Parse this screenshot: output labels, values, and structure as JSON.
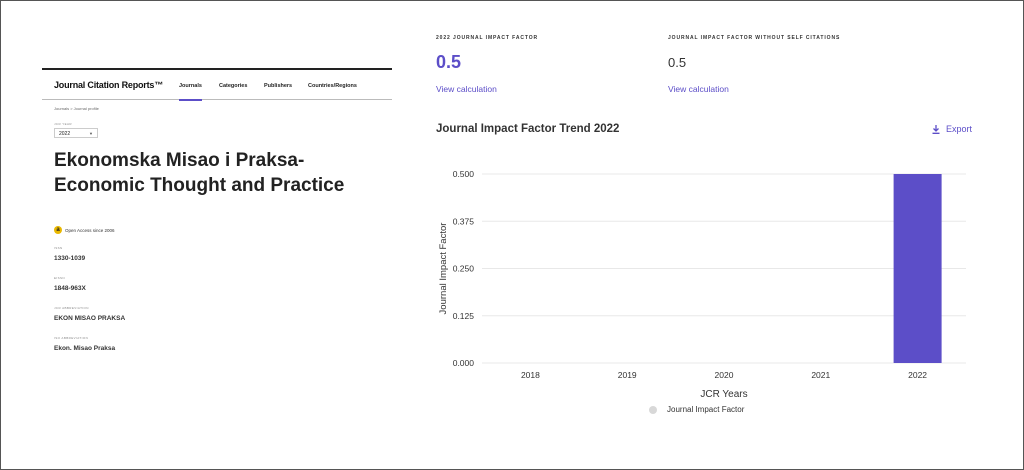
{
  "jcr": {
    "brand": "Journal Citation Reports™",
    "nav": [
      "Journals",
      "Categories",
      "Publishers",
      "Countries/Regions"
    ],
    "breadcrumb": "Journals  >  Journal profile",
    "year_label": "JCR YEAR",
    "year_value": "2022",
    "journal_title": "Ekonomska Misao i Praksa-Economic Thought and Practice",
    "open_access": "Open Access since 2006",
    "fields": [
      {
        "label": "ISSN",
        "value": "1330-1039"
      },
      {
        "label": "EISSN",
        "value": "1848-963X"
      },
      {
        "label": "JCR ABBREVIATION",
        "value": "EKON MISAO PRAKSA"
      },
      {
        "label": "ISO ABBREVIATION",
        "value": "Ekon. Misao Praksa"
      }
    ]
  },
  "kpis": {
    "jif_label": "2022 JOURNAL IMPACT FACTOR",
    "jif_value": "0.5",
    "jif_link": "View calculation",
    "jif_nsc_label": "JOURNAL IMPACT FACTOR WITHOUT SELF CITATIONS",
    "jif_nsc_value": "0.5",
    "jif_nsc_link": "View calculation"
  },
  "trend": {
    "title": "Journal Impact Factor Trend 2022",
    "export_label": "Export"
  },
  "colors": {
    "accent": "#5c4ec8",
    "bar": "#5c4ec8",
    "grid": "#e8e8e8",
    "legend_dot": "#d8d8d8"
  },
  "chart_data": {
    "type": "bar",
    "categories": [
      "2018",
      "2019",
      "2020",
      "2021",
      "2022"
    ],
    "series": [
      {
        "name": "Journal Impact Factor",
        "values": [
          0,
          0,
          0,
          0,
          0.5
        ]
      }
    ],
    "xlabel": "JCR Years",
    "ylabel": "Journal Impact Factor",
    "ylim": [
      0,
      0.5
    ],
    "yticks": [
      "0.000",
      "0.125",
      "0.250",
      "0.375",
      "0.500"
    ],
    "grid": true,
    "legend": "bottom"
  }
}
